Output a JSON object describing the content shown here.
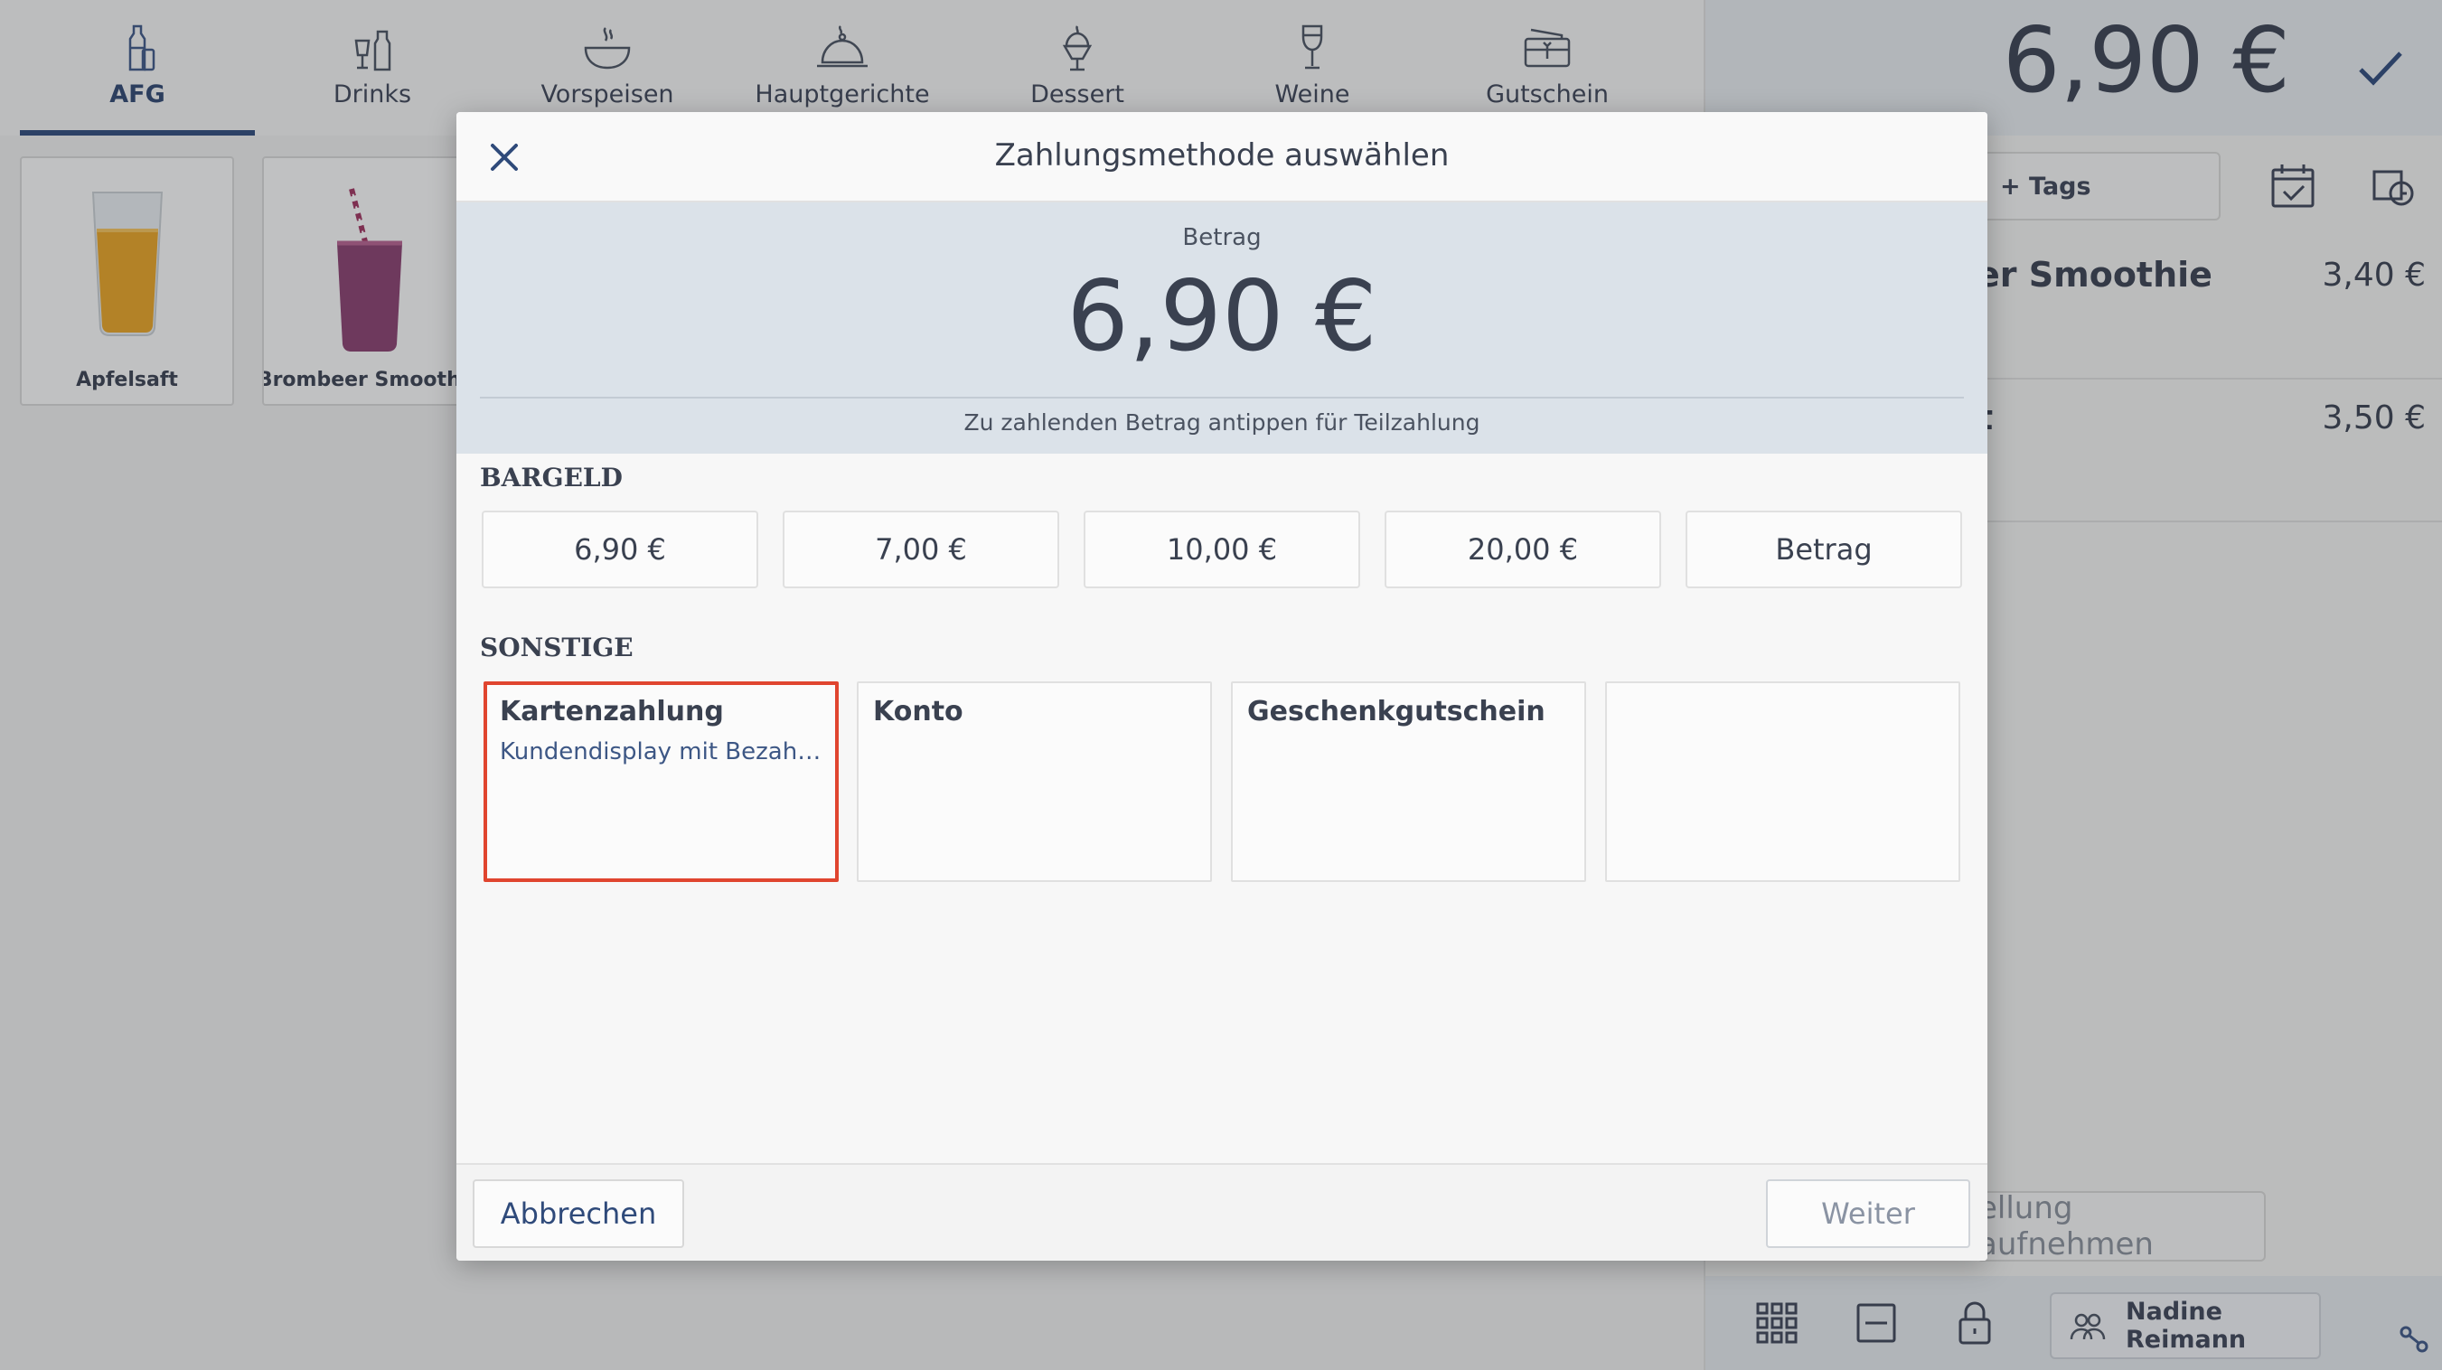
{
  "categories": [
    {
      "label": "AFG",
      "icon": "bottle-glass-icon",
      "active": true
    },
    {
      "label": "Drinks",
      "icon": "drinks-icon",
      "active": false
    },
    {
      "label": "Vorspeisen",
      "icon": "soup-bowl-icon",
      "active": false
    },
    {
      "label": "Hauptgerichte",
      "icon": "cloche-icon",
      "active": false
    },
    {
      "label": "Dessert",
      "icon": "ice-cream-icon",
      "active": false
    },
    {
      "label": "Weine",
      "icon": "wine-glass-icon",
      "active": false
    },
    {
      "label": "Gutschein",
      "icon": "voucher-icon",
      "active": false
    }
  ],
  "products": [
    {
      "label": "Apfelsaft",
      "icon": "apple-juice-glass-icon"
    },
    {
      "label": "Brombeer Smoothie",
      "icon": "smoothie-glass-icon"
    }
  ],
  "sidebar": {
    "total": "6,90 €",
    "tags_label": "+ Tags",
    "order_lines": [
      {
        "name": "er Smoothie",
        "price": "3,40 €"
      },
      {
        "name": "t",
        "price": "3,50 €"
      }
    ],
    "order_button": "ellung aufnehmen",
    "user_name": "Nadine Reimann"
  },
  "dialog": {
    "title": "Zahlungsmethode auswählen",
    "amount_label": "Betrag",
    "amount_value": "6,90 €",
    "amount_hint": "Zu zahlenden Betrag antippen für Teilzahlung",
    "cash_section": "BARGELD",
    "cash_options": [
      "6,90 €",
      "7,00 €",
      "10,00 €",
      "20,00 €",
      "Betrag"
    ],
    "other_section": "SONSTIGE",
    "other_options": [
      {
        "title": "Kartenzahlung",
        "subtitle": "Kundendisplay mit Bezahlfunktion",
        "selected": true
      },
      {
        "title": "Konto",
        "subtitle": "",
        "selected": false
      },
      {
        "title": "Geschenkgutschein",
        "subtitle": "",
        "selected": false
      },
      {
        "title": "",
        "subtitle": "",
        "selected": false
      }
    ],
    "cancel_label": "Abbrechen",
    "next_label": "Weiter"
  },
  "colors": {
    "accent": "#2f4a7a",
    "selection_border": "#e0452f",
    "amount_bg": "#dbe2e9",
    "disabled_text": "#8a93a3"
  }
}
